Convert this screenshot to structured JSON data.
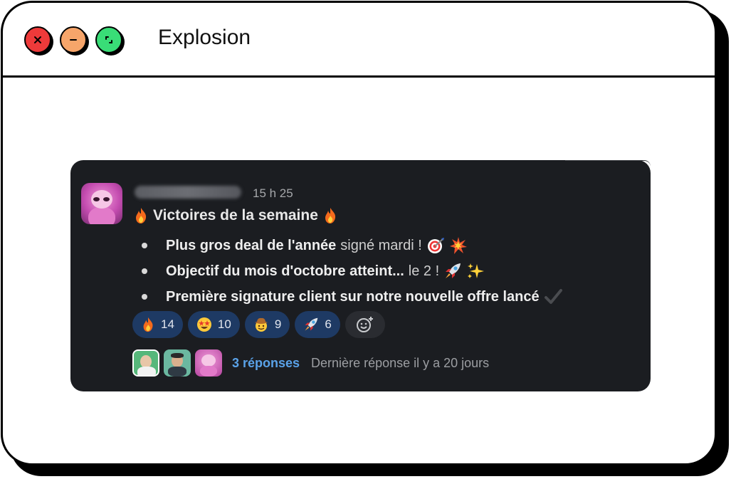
{
  "window": {
    "title": "Explosion",
    "controls": {
      "close_glyph": "×",
      "minimize_glyph": "–"
    }
  },
  "message": {
    "timestamp": "15 h 25",
    "heading": "Victoires de la semaine",
    "items": [
      {
        "bold": "Plus gros deal de l'année",
        "rest": "signé mardi !"
      },
      {
        "bold": "Objectif du mois d'octobre atteint...",
        "rest": "le 2 !"
      },
      {
        "bold": "Première signature client  sur notre nouvelle offre lancé",
        "rest": ""
      }
    ],
    "reactions": [
      {
        "emoji": "fire-icon",
        "count": "14"
      },
      {
        "emoji": "star-struck-icon",
        "count": "10"
      },
      {
        "emoji": "cowboy-face-icon",
        "count": "9"
      },
      {
        "emoji": "rocket-icon",
        "count": "6"
      }
    ],
    "thread": {
      "replies_label": "3 réponses",
      "last_reply": "Dernière réponse il y a 20 jours"
    }
  },
  "colors": {
    "card_bg": "#1b1d21",
    "reaction_bg": "#1e3a64",
    "link": "#5aa2e8",
    "close": "#ee3a3a",
    "minimize": "#f7a56a",
    "maximize": "#39dd77"
  }
}
